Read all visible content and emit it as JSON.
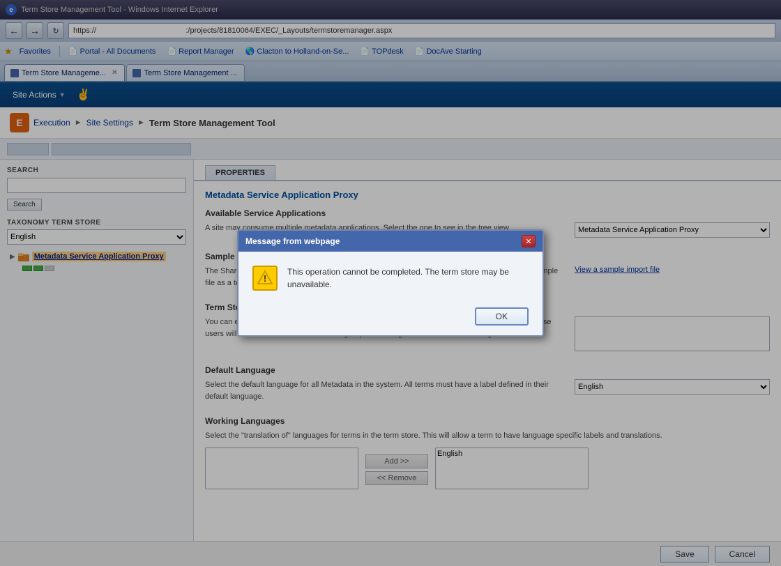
{
  "browser": {
    "title": "Term Store Management Tool - Windows Internet Explorer",
    "address": "https://                                          :/projects/81810064/EXEC/_Layouts/termstoremanager.aspx",
    "tabs": [
      {
        "label": "Term Store Manageme...",
        "active": true
      },
      {
        "label": "Term Store Management ...",
        "active": false
      }
    ],
    "favorites": [
      {
        "label": "Favorites"
      },
      {
        "label": "Portal - All Documents"
      },
      {
        "label": "Report Manager"
      },
      {
        "label": "Clacton to Holland-on-Se..."
      },
      {
        "label": "TOPdesk"
      },
      {
        "label": "DocAve Starting"
      }
    ]
  },
  "sharepoint": {
    "site_actions_label": "Site Actions",
    "breadcrumb": [
      {
        "label": "Execution",
        "link": true
      },
      {
        "label": "Site Settings",
        "link": true
      },
      {
        "label": "Term Store Management Tool",
        "link": false
      }
    ]
  },
  "sidebar": {
    "search_label": "SEARCH",
    "search_placeholder": "",
    "search_btn": "Search",
    "taxonomy_label": "TAXONOMY TERM STORE",
    "taxonomy_value": "English",
    "tree_item_label": "Metadata Service Application Proxy"
  },
  "properties": {
    "tab_label": "PROPERTIES",
    "section_title": "Metadata Service Application Proxy",
    "available_service_label": "Available Service Applications",
    "available_service_desc": "A site may consume multiple metadata applications. Select the one to see in the tree view.",
    "available_service_value": "Metadata Service Application Proxy",
    "sample_import_label": "Sample Import",
    "sample_import_desc": "The SharePoint metadata manager can import a term set from a UTF-8 CSV format file. Use the sample file as a template for creating import files. Then import the file to create a new term set.",
    "sample_import_link": "View a sample import file",
    "term_store_admin_label": "Term Store Administrators",
    "term_store_admin_desc": "You can enter user names, group names, or e-mail addresses. Separate them with semicolons. These users will be able to create new term set groups and assign users to the term manager role.",
    "default_language_label": "Default Language",
    "default_language_desc": "Select the default language for all Metadata in the system. All terms must have a label defined in their default language.",
    "default_language_value": "English",
    "working_languages_label": "Working Languages",
    "working_languages_desc": "Select the \"translation of\" languages for terms in the term store. This will allow a term to have language specific labels and translations.",
    "add_btn": "Add >>",
    "remove_btn": "<< Remove",
    "working_lang_right": "English",
    "save_btn": "Save",
    "cancel_btn": "Cancel"
  },
  "modal": {
    "title": "Message from webpage",
    "message": "This operation cannot be completed. The term store may be unavailable.",
    "ok_btn": "OK"
  }
}
